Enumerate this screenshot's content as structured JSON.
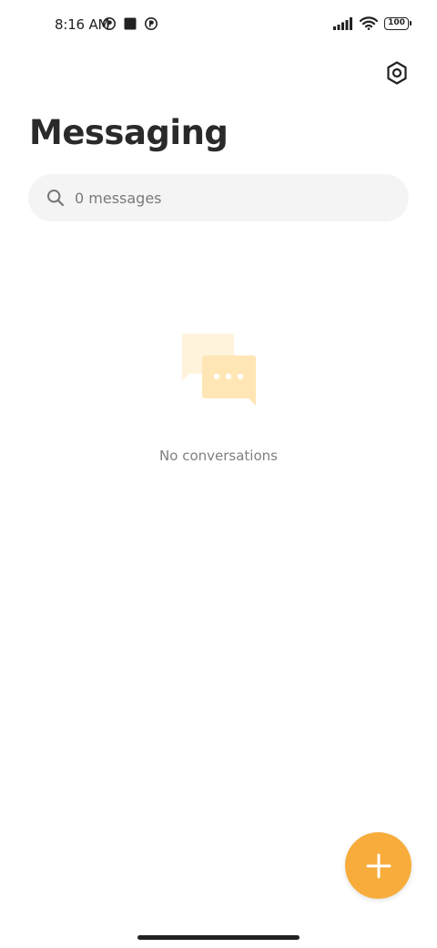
{
  "status_bar": {
    "time": "8:16 AM",
    "battery_level": "100",
    "left_icons": [
      "notification-app-icon",
      "stop-square-icon",
      "notification-app-icon"
    ],
    "right_icons": [
      "cellular-signal-icon",
      "wifi-icon",
      "battery-icon"
    ]
  },
  "header": {
    "title": "Messaging",
    "settings_icon": "settings-hexagon-icon"
  },
  "search": {
    "placeholder": "0 messages",
    "icon": "search-icon"
  },
  "empty_state": {
    "icon": "chat-bubbles-icon",
    "message": "No conversations"
  },
  "fab": {
    "icon": "plus-icon"
  },
  "colors": {
    "accent": "#f7ac3b",
    "illustration_light": "#fff3dc",
    "illustration_dark": "#ffe6b4",
    "search_background": "#f4f4f4"
  }
}
